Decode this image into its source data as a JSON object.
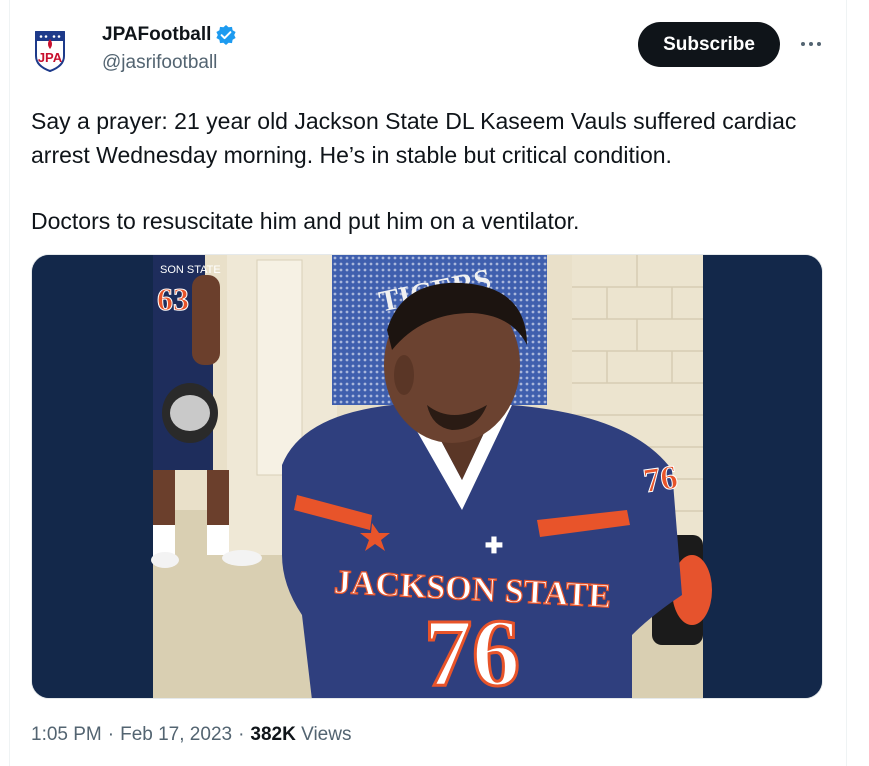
{
  "account": {
    "display_name": "JPAFootball",
    "handle": "@jasrifootball",
    "avatar_text": "JPA"
  },
  "header": {
    "subscribe_label": "Subscribe",
    "more_icon": "more-horizontal-icon",
    "verified_icon": "verified-badge-icon"
  },
  "tweet": {
    "paragraph_1": "Say a prayer: 21 year old Jackson State DL Kaseem Vauls suffered cardiac arrest Wednesday morning. He’s in stable but critical condition.",
    "paragraph_2": "Doctors to resuscitate him and put him on a ventilator."
  },
  "photo": {
    "jersey_text": "JACKSON STATE",
    "jersey_number": "76",
    "background_jersey_text": "TIGERS",
    "left_player_number": "63",
    "left_player_text": "SON STATE",
    "sleeve_number": "76"
  },
  "meta": {
    "time": "1:05 PM",
    "dot_1": "·",
    "date": "Feb 17, 2023",
    "dot_2": "·",
    "views_count": "382K",
    "views_label": "Views"
  },
  "colors": {
    "subscribe_bg": "#0f1419",
    "verified": "#1d9bf0",
    "media_bg": "#13284a",
    "jersey_navy": "#2f3f7e",
    "jersey_orange": "#e8542a"
  }
}
